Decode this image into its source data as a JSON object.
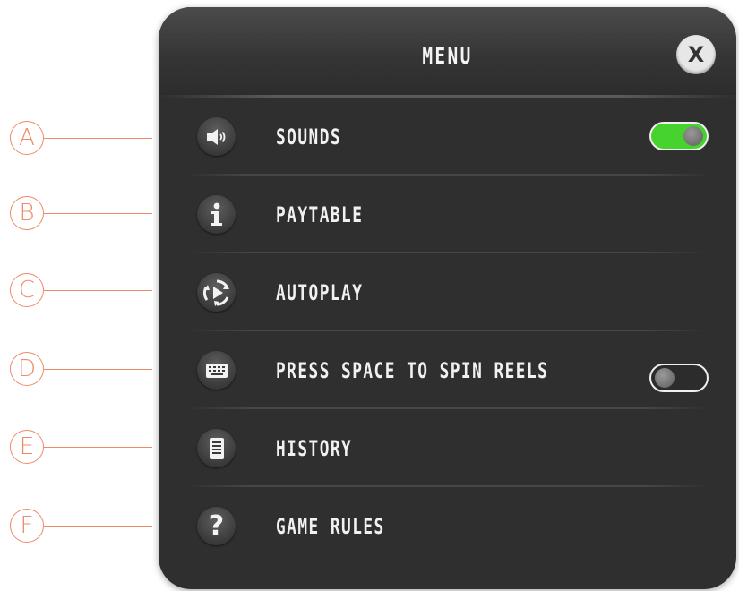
{
  "callouts": [
    "A",
    "B",
    "C",
    "D",
    "E",
    "F"
  ],
  "menu": {
    "title": "MENU",
    "close_label": "X",
    "items": [
      {
        "label": "SOUNDS",
        "icon": "speaker-icon",
        "toggle": "on"
      },
      {
        "label": "PAYTABLE",
        "icon": "info-icon"
      },
      {
        "label": "AUTOPLAY",
        "icon": "autoplay-icon"
      },
      {
        "label": "PRESS SPACE TO SPIN REELS",
        "icon": "keyboard-icon",
        "toggle": "off"
      },
      {
        "label": "HISTORY",
        "icon": "history-icon"
      },
      {
        "label": "GAME RULES",
        "icon": "question-icon"
      }
    ]
  },
  "colors": {
    "accent_callout": "#ee8a6a",
    "toggle_on": "#47d32e",
    "panel_bg": "#2f2f2f"
  }
}
